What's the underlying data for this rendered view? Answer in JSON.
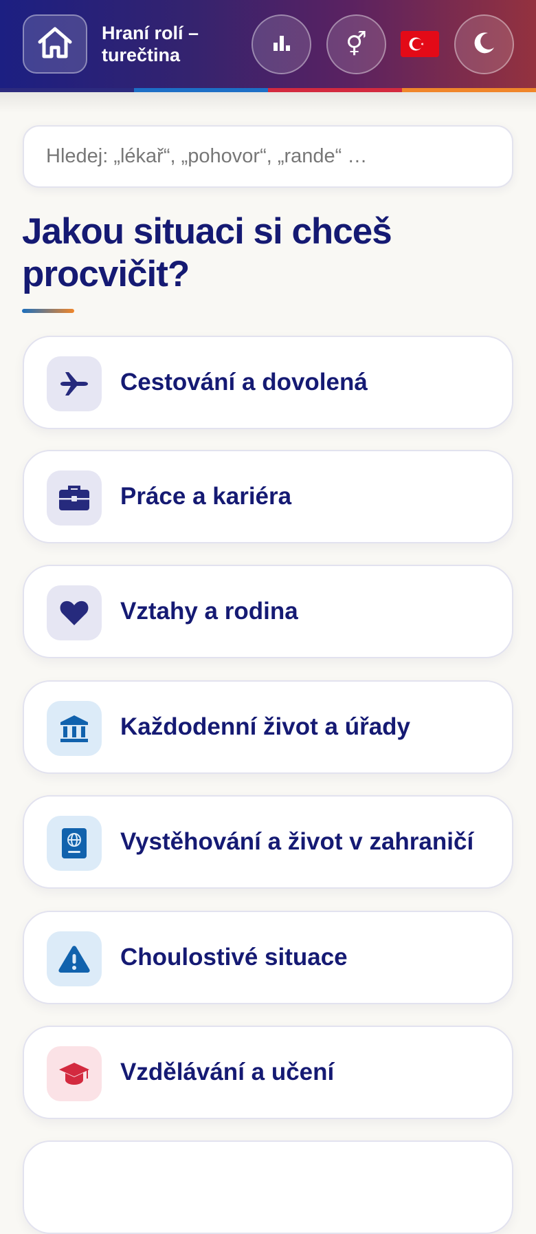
{
  "header": {
    "title": "Hraní rolí – turečtina",
    "home_icon": "home-icon",
    "stats_icon": "bar-chart-icon",
    "gender_icon": "gender-icon",
    "gender_glyph": "⚥",
    "flag": "turkey-flag",
    "theme_icon": "moon-icon",
    "strip_colors": [
      "#2c2a7e",
      "#1d6fc6",
      "#d32a3f",
      "#f0862a"
    ]
  },
  "search": {
    "placeholder": "Hledej: „lékař“, „pohovor“, „rande“ …",
    "value": ""
  },
  "heading": "Jakou situaci si chceš procvičit?",
  "categories": [
    {
      "label": "Cestování a dovolená",
      "icon": "plane-icon",
      "tint": "#e6e6f3",
      "color": "#262a7d"
    },
    {
      "label": "Práce a kariéra",
      "icon": "briefcase-icon",
      "tint": "#e6e6f3",
      "color": "#262a7d"
    },
    {
      "label": "Vztahy a rodina",
      "icon": "heart-icon",
      "tint": "#e6e6f3",
      "color": "#262a7d"
    },
    {
      "label": "Každodenní život a úřady",
      "icon": "bank-icon",
      "tint": "#dcebf8",
      "color": "#1162ad"
    },
    {
      "label": "Vystěhování a život v zahraničí",
      "icon": "passport-icon",
      "tint": "#dcebf8",
      "color": "#1162ad"
    },
    {
      "label": "Choulostivé situace",
      "icon": "warning-icon",
      "tint": "#dcebf8",
      "color": "#1162ad"
    },
    {
      "label": "Vzdělávání a učení",
      "icon": "graduation-cap-icon",
      "tint": "#fbe2e6",
      "color": "#d32a3f"
    }
  ]
}
